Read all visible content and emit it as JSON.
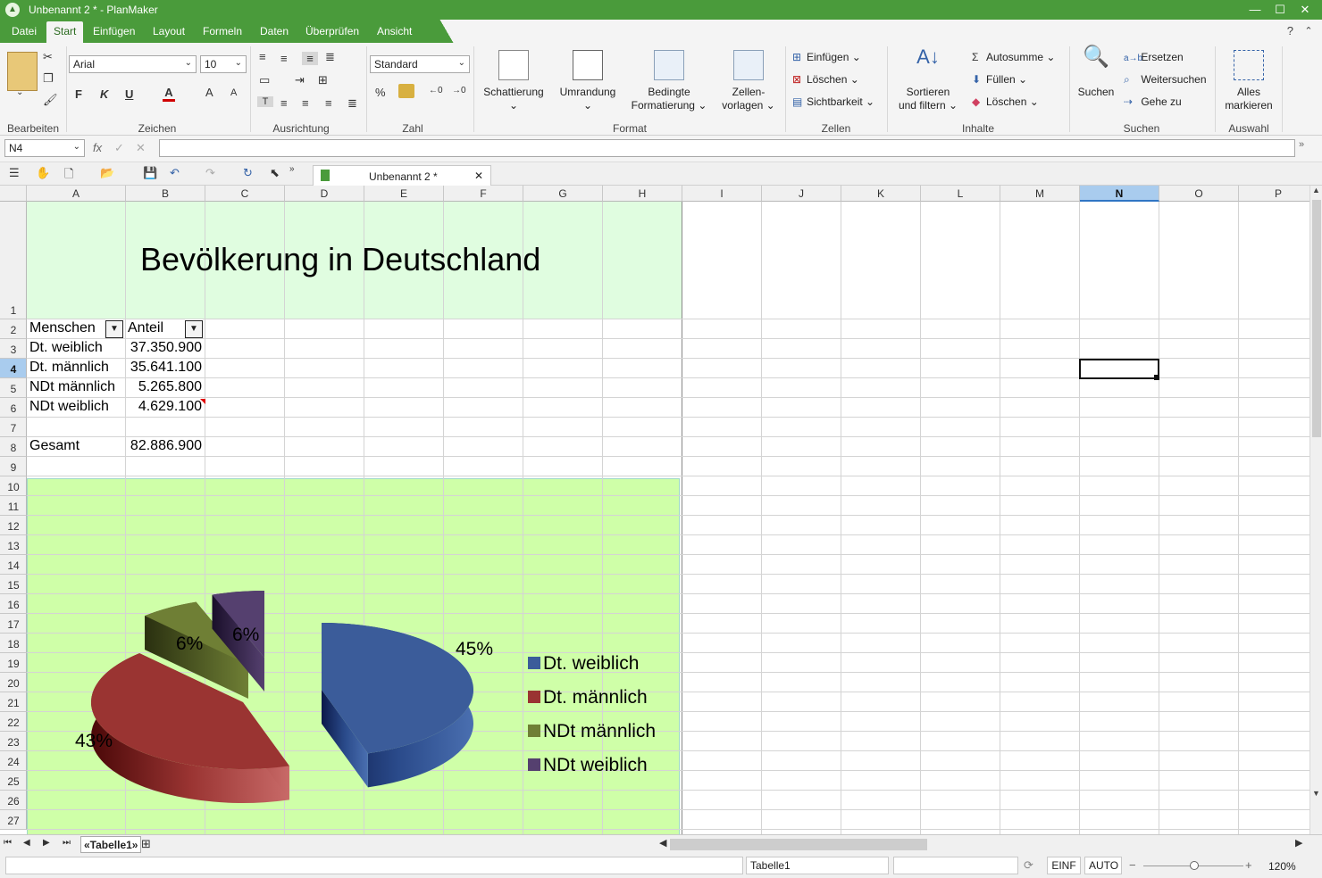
{
  "window": {
    "title": "Unbenannt 2 * - PlanMaker",
    "help": "?"
  },
  "menu": [
    "Datei",
    "Start",
    "Einfügen",
    "Layout",
    "Formeln",
    "Daten",
    "Überprüfen",
    "Ansicht"
  ],
  "ribbon": {
    "groups": {
      "bearbeiten": "Bearbeiten",
      "zeichen": "Zeichen",
      "ausrichtung": "Ausrichtung",
      "zahl": "Zahl",
      "format": "Format",
      "zellen": "Zellen",
      "inhalte": "Inhalte",
      "suchen": "Suchen",
      "auswahl": "Auswahl"
    },
    "font": "Arial",
    "size": "10",
    "numformat": "Standard",
    "bold": "F",
    "italic": "K",
    "underline": "U",
    "fontcolor": "A",
    "grow": "A",
    "shrink": "A",
    "percent": "%",
    "schattierung": "Schattierung",
    "umrandung": "Umrandung",
    "bedingte1": "Bedingte",
    "bedingte2": "Formatierung",
    "zellenvorlagen1": "Zellen-",
    "zellenvorlagen2": "vorlagen",
    "z_einfuegen": "Einfügen",
    "z_loeschen": "Löschen",
    "z_sichtbarkeit": "Sichtbarkeit",
    "sortieren1": "Sortieren",
    "sortieren2": "und filtern",
    "autosumme": "Autosumme",
    "fuellen": "Füllen",
    "i_loeschen": "Löschen",
    "suchen": "Suchen",
    "ersetzen": "Ersetzen",
    "weitersuchen": "Weitersuchen",
    "gehezu": "Gehe zu",
    "alles1": "Alles",
    "alles2": "markieren"
  },
  "formula": {
    "cellref": "N4",
    "fx": "fx",
    "value": ""
  },
  "doctab": {
    "name": "Unbenannt 2 *"
  },
  "columns": [
    "A",
    "B",
    "C",
    "D",
    "E",
    "F",
    "G",
    "H",
    "I",
    "J",
    "K",
    "L",
    "M",
    "N",
    "O",
    "P"
  ],
  "rows": [
    "1",
    "2",
    "3",
    "4",
    "5",
    "6",
    "7",
    "8",
    "9",
    "10",
    "11",
    "12",
    "13",
    "14",
    "15",
    "16",
    "17",
    "18",
    "19",
    "20",
    "21",
    "22",
    "23",
    "24",
    "25",
    "26",
    "27"
  ],
  "sheet": {
    "title": "Bevölkerung in Deutschland",
    "header_a": "Menschen",
    "header_b": "Anteil",
    "data": [
      {
        "label": "Dt. weiblich",
        "value": "37.350.900"
      },
      {
        "label": "Dt. männlich",
        "value": "35.641.100"
      },
      {
        "label": "NDt männlich",
        "value": "5.265.800"
      },
      {
        "label": "NDt weiblich",
        "value": "4.629.100"
      }
    ],
    "total_label": "Gesamt",
    "total_value": "82.886.900"
  },
  "chart_data": {
    "type": "pie",
    "categories": [
      "Dt. weiblich",
      "Dt. männlich",
      "NDt männlich",
      "NDt weiblich"
    ],
    "values": [
      37350900,
      35641100,
      5265800,
      4629100
    ],
    "labels": [
      "45%",
      "43%",
      "6%",
      "6%"
    ],
    "colors": [
      "#3b5c9a",
      "#9a3432",
      "#6f7f35",
      "#55406f"
    ],
    "legend": "right",
    "exploded": true,
    "style": "3d"
  },
  "sheettab": {
    "name": "«Tabelle1»"
  },
  "status": {
    "sheet": "Tabelle1",
    "mode1": "EINF",
    "mode2": "AUTO",
    "zoom": "120%"
  }
}
